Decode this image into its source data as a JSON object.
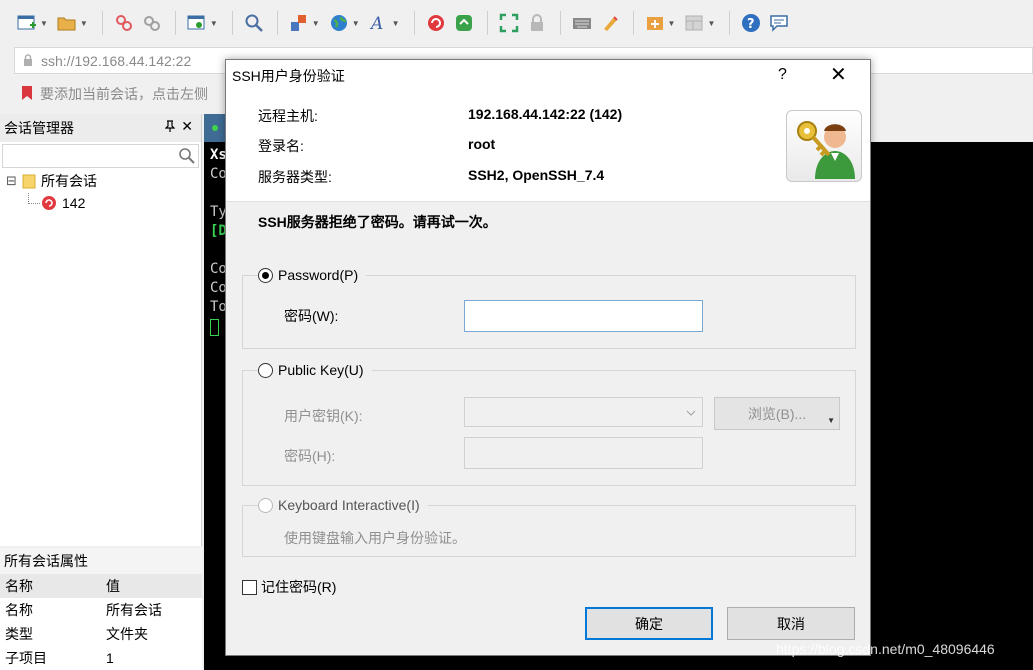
{
  "toolbar": {
    "icons": [
      "new-session-icon",
      "open-folder-icon",
      "disconnect-icon",
      "reconnect-icon",
      "new-window-icon",
      "find-icon",
      "transfer-icon",
      "globe-icon",
      "font-icon",
      "xshell-icon",
      "xftp-icon",
      "fullscreen-icon",
      "lock-icon",
      "keyboard-icon",
      "highlight-icon",
      "add-icon",
      "layout-icon",
      "help-icon",
      "chat-icon"
    ]
  },
  "address": {
    "value": "ssh://192.168.44.142:22"
  },
  "hint": {
    "text": "要添加当前会话，点击左侧"
  },
  "session_manager": {
    "title": "会话管理器",
    "pin_glyph": "↓",
    "close_glyph": "✕",
    "search_placeholder": "",
    "tree": {
      "root_label": "所有会话",
      "root_toggle": "⊟",
      "child_label": "142"
    }
  },
  "properties": {
    "title": "所有会话属性",
    "header": {
      "name": "名称",
      "value": "值"
    },
    "rows": [
      {
        "name": "名称",
        "value": "所有会话"
      },
      {
        "name": "类型",
        "value": "文件夹"
      },
      {
        "name": "子项目",
        "value": "1"
      }
    ]
  },
  "terminal": {
    "lines": [
      {
        "text": "Xs",
        "color": "#ffffff",
        "bold": true
      },
      {
        "text": "Co",
        "color": "#d0d0d0",
        "bold": false
      },
      {
        "text": "",
        "color": "#d0d0d0",
        "bold": false
      },
      {
        "text": "Ty",
        "color": "#d0d0d0",
        "bold": false
      },
      {
        "text": "[D",
        "color": "#39d353",
        "bold": true
      },
      {
        "text": "",
        "color": "#d0d0d0",
        "bold": false
      },
      {
        "text": "Co",
        "color": "#d0d0d0",
        "bold": false
      },
      {
        "text": "Co",
        "color": "#d0d0d0",
        "bold": false
      },
      {
        "text": "To",
        "color": "#d0d0d0",
        "bold": false
      }
    ]
  },
  "dialog": {
    "title": "SSH用户身份验证",
    "help": "?",
    "close": "✕",
    "info": {
      "host_label": "远程主机:",
      "host_value": "192.168.44.142:22 (142)",
      "login_label": "登录名:",
      "login_value": "root",
      "server_label": "服务器类型:",
      "server_value": "SSH2, OpenSSH_7.4"
    },
    "error": "SSH服务器拒绝了密码。请再试一次。",
    "password_group": {
      "label": "Password(P)",
      "field_label": "密码(W):",
      "field_value": ""
    },
    "pubkey_group": {
      "label": "Public Key(U)",
      "user_key_label": "用户密钥(K):",
      "user_key_value": "",
      "browse_label": "浏览(B)...",
      "passphrase_label": "密码(H):",
      "passphrase_value": ""
    },
    "keyboard_group": {
      "label": "Keyboard Interactive(I)",
      "description": "使用键盘输入用户身份验证。"
    },
    "remember_label": "记住密码(R)",
    "ok_label": "确定",
    "cancel_label": "取消"
  },
  "watermark": "https://blog.csdn.net/m0_48096446"
}
